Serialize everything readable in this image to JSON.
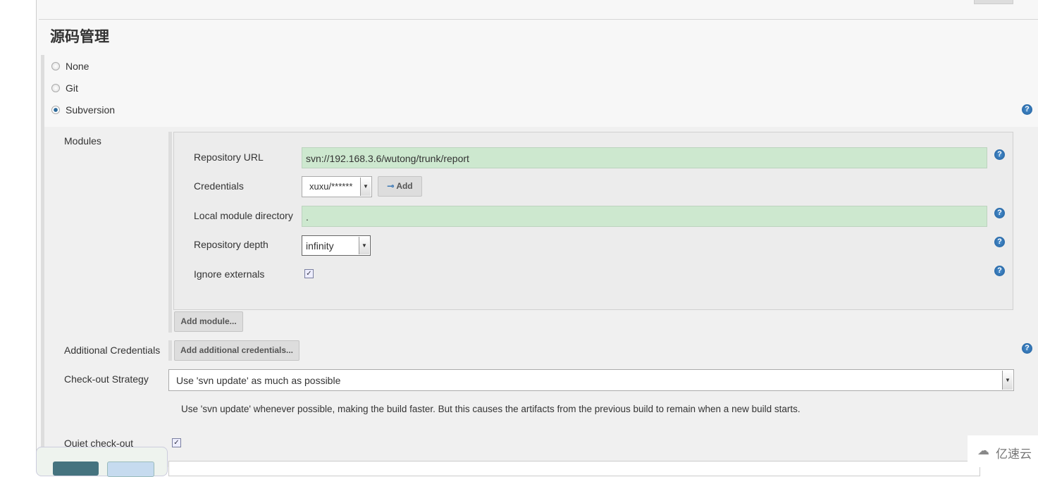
{
  "section_title": "源码管理",
  "scm_options": [
    {
      "label": "None",
      "selected": false
    },
    {
      "label": "Git",
      "selected": false
    },
    {
      "label": "Subversion",
      "selected": true
    }
  ],
  "modules": {
    "label": "Modules",
    "repository_url": {
      "label": "Repository URL",
      "value": "svn://192.168.3.6/wutong/trunk/report"
    },
    "credentials": {
      "label": "Credentials",
      "value": "xuxu/******",
      "add_label": "Add"
    },
    "local_module_directory": {
      "label": "Local module directory",
      "value": "."
    },
    "repository_depth": {
      "label": "Repository depth",
      "value": "infinity"
    },
    "ignore_externals": {
      "label": "Ignore externals",
      "checked": true
    },
    "add_module_label": "Add module..."
  },
  "additional_credentials": {
    "label": "Additional Credentials",
    "button_label": "Add additional credentials..."
  },
  "checkout_strategy": {
    "label": "Check-out Strategy",
    "value": "Use 'svn update' as much as possible",
    "description": "Use 'svn update' whenever possible, making the build faster. But this causes the artifacts from the previous build to remain when a new build starts."
  },
  "quiet_checkout": {
    "label": "Quiet check-out",
    "checked": true
  },
  "watermark": "亿速云",
  "colors": {
    "input_bg": "#cde8cf",
    "save_button": "#45737f",
    "apply_button": "#c6dbef"
  }
}
